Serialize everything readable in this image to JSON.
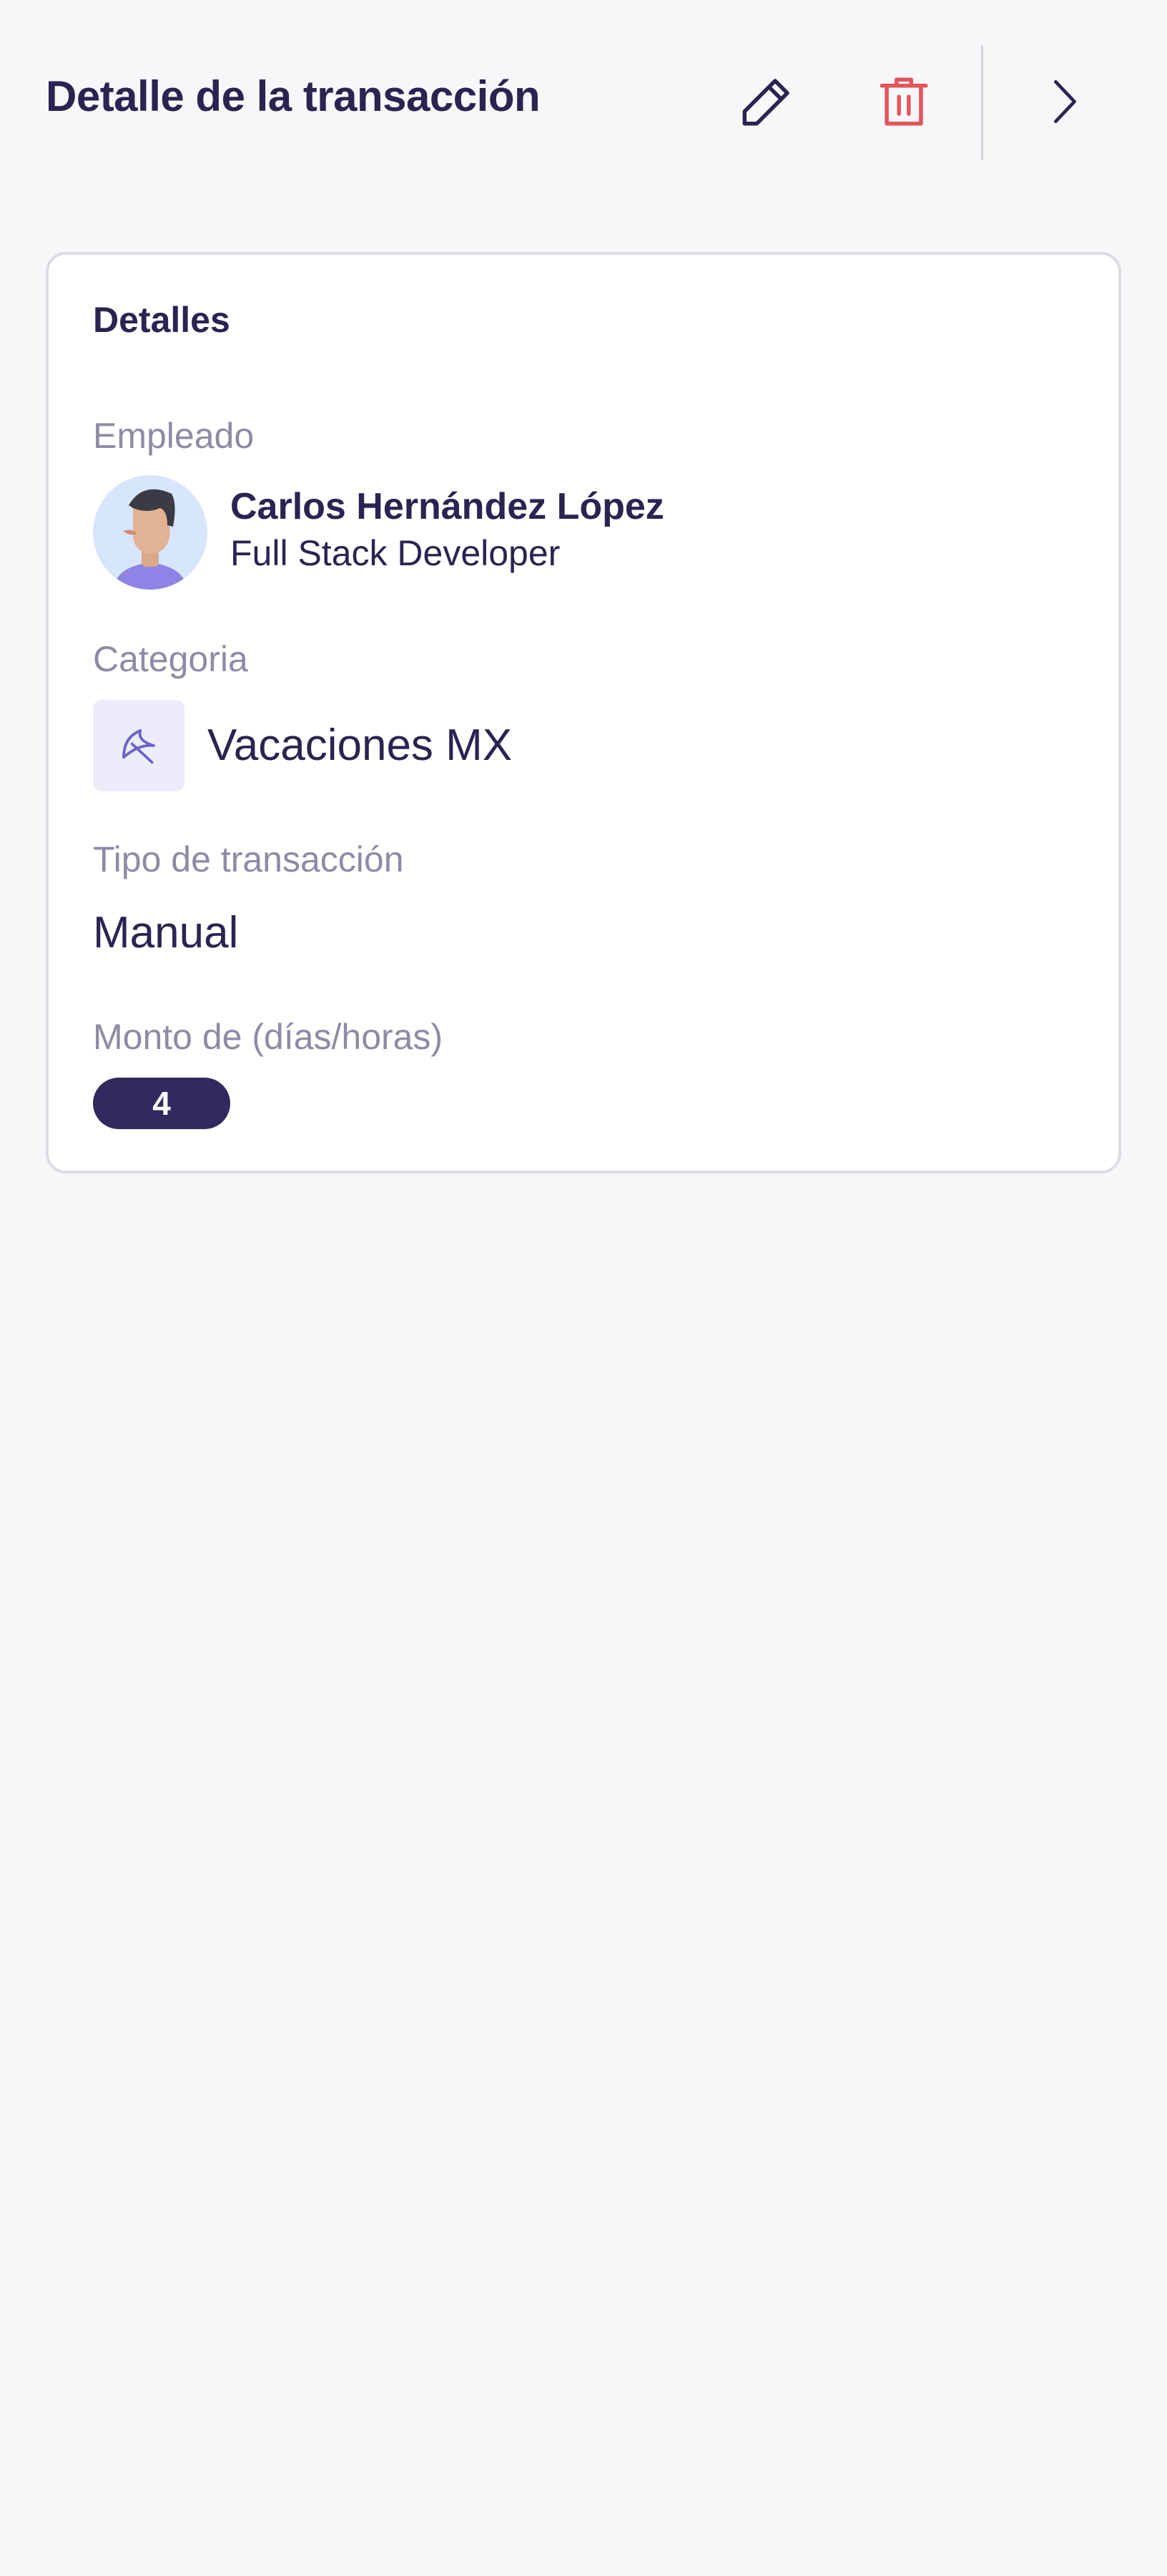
{
  "header": {
    "title": "Detalle de la transacción",
    "icons": {
      "edit": "pencil-icon",
      "delete": "trash-icon",
      "next": "chevron-right-icon"
    },
    "colors": {
      "delete": "#e5535a",
      "primary": "#2a2452"
    }
  },
  "card": {
    "title": "Detalles",
    "employee": {
      "label": "Empleado",
      "name": "Carlos Hernández López",
      "role": "Full Stack Developer"
    },
    "category": {
      "label": "Categoria",
      "name": "Vacaciones MX",
      "icon": "umbrella-icon"
    },
    "transaction_type": {
      "label": "Tipo de transacción",
      "value": "Manual"
    },
    "amount": {
      "label": "Monto de (días/horas)",
      "value": "4"
    }
  }
}
